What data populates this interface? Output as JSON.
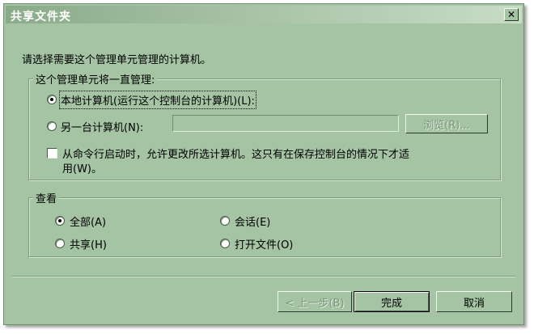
{
  "dialog": {
    "title": "共享文件夹",
    "close_symbol": "✕"
  },
  "instruction": "请选择需要这个管理单元管理的计算机。",
  "managed_group": {
    "label": "这个管理单元将一直管理:",
    "local_radio": {
      "label": "本地计算机(运行这个控制台的计算机)(L):",
      "checked": true
    },
    "other_radio": {
      "label": "另一台计算机(N):",
      "checked": false
    },
    "computer_input": {
      "value": ""
    },
    "browse_button": "浏览(R)...",
    "allow_change_checkbox": {
      "label_line1": "从命令行启动时，允许更改所选计算机。这只有在保存控制台的情况下才适",
      "label_line2": "用(W)。",
      "checked": false
    }
  },
  "view_group": {
    "label": "查看",
    "options": {
      "all": {
        "label": "全部(A)",
        "checked": true
      },
      "sessions": {
        "label": "会话(E)",
        "checked": false
      },
      "shares": {
        "label": "共享(H)",
        "checked": false
      },
      "open_files": {
        "label": "打开文件(O)",
        "checked": false
      }
    }
  },
  "buttons": {
    "back": "< 上一步(B)",
    "finish": "完成",
    "cancel": "取消"
  },
  "colors": {
    "dialog_bg": "#a4c4a4",
    "title_text": "#ffffff",
    "disabled_text": "#7d957d"
  }
}
